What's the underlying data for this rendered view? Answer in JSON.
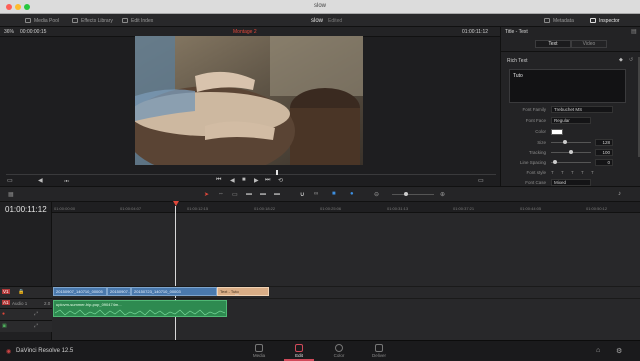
{
  "window": {
    "title": "slow"
  },
  "toolbar": {
    "media_pool": "Media Pool",
    "effects_library": "Effects Library",
    "edit_index": "Edit Index",
    "project_name": "slow",
    "project_status": "Edited",
    "metadata": "Metadata",
    "inspector": "Inspector"
  },
  "viewer": {
    "zoom": "36%",
    "source_timecode": "00:00:00:15",
    "timeline_name": "Montage 2",
    "record_timecode": "01:00:11:12"
  },
  "inspector": {
    "title": "Title - Text",
    "tabs": [
      "Text",
      "Video"
    ],
    "section": "Rich Text",
    "text_value": "Tuto",
    "font_family_label": "Font Family",
    "font_family_value": "Trebuchet MS",
    "font_face_label": "Font Face",
    "font_face_value": "Regular",
    "color_label": "Color",
    "size_label": "Size",
    "size_value": "128",
    "tracking_label": "Tracking",
    "tracking_value": "100",
    "line_spacing_label": "Line Spacing",
    "line_spacing_value": "0",
    "font_style_label": "Font style",
    "font_style_glyphs": [
      "T",
      "T",
      "T",
      "T",
      "T"
    ],
    "font_case_label": "Font Case",
    "font_case_value": "Mixed"
  },
  "timeline": {
    "timecode": "01:00:11:12",
    "ticks": [
      "01:00:00:00",
      "01:00:04:07",
      "01:00:12:15",
      "01:00:18:22",
      "01:00:25:06",
      "01:00:31:13",
      "01:00:37:21",
      "01:00:44:05",
      "01:00:50:12"
    ],
    "tracks": {
      "v1": "V1",
      "a1": "A1",
      "audio_name": "Audio 1",
      "audio_level": "2.0"
    },
    "clips": {
      "c1": "20150907_140710_00005",
      "c2": "20150907...",
      "c3": "20150723_140710_00003",
      "title": "Text - Tuto",
      "audio": "uplovm-summer-hip-pop_090474m..."
    }
  },
  "footer": {
    "app_name": "DaVinci Resolve 12.5",
    "pages": [
      "Media",
      "Edit",
      "Color",
      "Deliver"
    ]
  },
  "colors": {
    "accent": "#e0473a",
    "video_clip": "#3d6fa3",
    "title_clip": "#cfa07a",
    "audio_clip": "#2f8f53",
    "edit_active": "#d14a5a"
  }
}
